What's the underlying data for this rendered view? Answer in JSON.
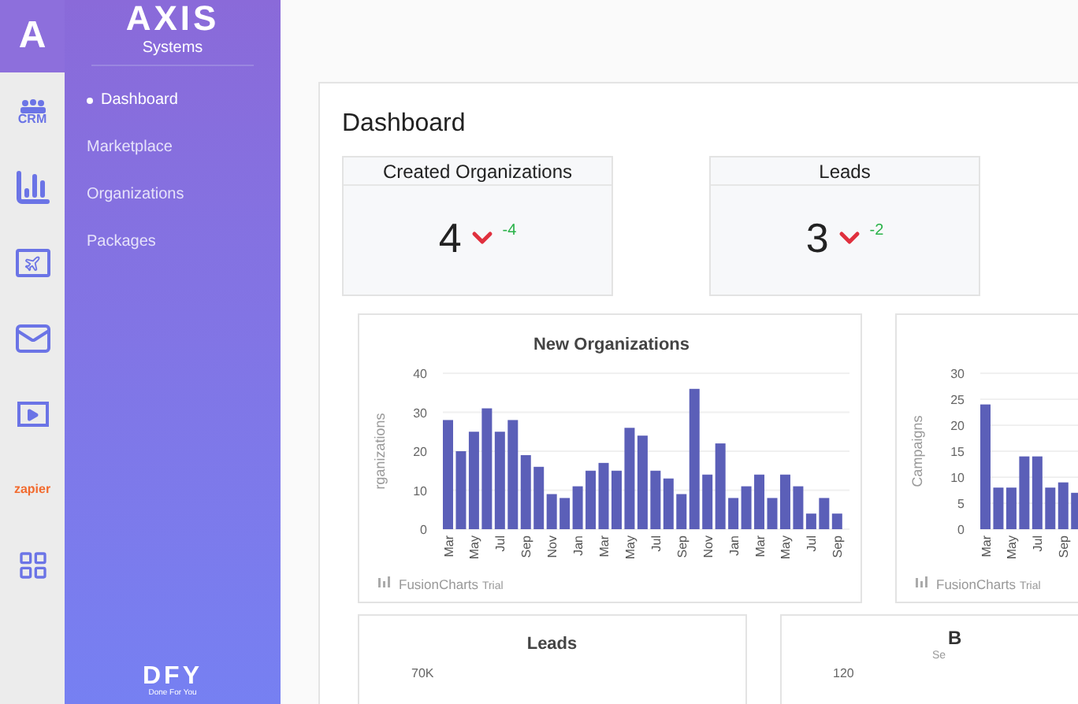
{
  "brand": {
    "logo_letter": "A",
    "name": "AXIS",
    "subtitle": "Systems",
    "footer_logo": "DFY",
    "footer_tagline": "Done For You"
  },
  "rail": [
    {
      "kind": "crm",
      "label": "CRM"
    },
    {
      "kind": "bars"
    },
    {
      "kind": "window"
    },
    {
      "kind": "mail"
    },
    {
      "kind": "video"
    },
    {
      "kind": "zapier",
      "label": "zapier"
    },
    {
      "kind": "widget"
    }
  ],
  "sidebar": {
    "items": [
      {
        "label": "Dashboard",
        "selected": true
      },
      {
        "label": "Marketplace",
        "selected": false
      },
      {
        "label": "Organizations",
        "selected": false
      },
      {
        "label": "Packages",
        "selected": false
      }
    ]
  },
  "page": {
    "title": "Dashboard"
  },
  "stats": [
    {
      "title": "Created Organizations",
      "value": "4",
      "kind": "down",
      "delta": "-4"
    },
    {
      "title": "Leads",
      "value": "3",
      "kind": "down",
      "delta": "-2"
    }
  ],
  "charts": [
    {
      "credit": "FusionCharts",
      "credit_suffix": "Trial",
      "chart_data": {
        "type": "bar",
        "title": "New Organizations",
        "ylabel": "rganizations",
        "grid": true,
        "categories": [
          "Mar",
          null,
          "May",
          null,
          "Jul",
          null,
          "Sep",
          null,
          "Nov",
          null,
          "Jan",
          null,
          "Mar",
          null,
          "May",
          null,
          "Jul",
          null,
          "Sep",
          null,
          "Nov",
          null,
          "Jan",
          null,
          "Mar",
          null,
          "May",
          null,
          "Jul",
          null,
          "Sep"
        ],
        "series": [
          {
            "color": "#5b5fb8",
            "values": [
              28,
              20,
              25,
              31,
              25,
              28,
              19,
              16,
              9,
              8,
              11,
              15,
              17,
              15,
              26,
              24,
              15,
              13,
              9,
              36,
              14,
              22,
              8,
              11,
              14,
              8,
              14,
              11,
              4,
              8,
              4
            ]
          }
        ],
        "ylim": [
          0,
          40
        ],
        "yticks": [
          0,
          10,
          20,
          30,
          40
        ]
      }
    },
    {
      "credit": "FusionCharts",
      "credit_suffix": "Trial",
      "chart_data": {
        "type": "bar",
        "ylabel": "Campaigns",
        "grid": true,
        "categories": [
          "Mar",
          null,
          "May",
          null,
          "Jul",
          null,
          "Sep",
          null
        ],
        "series": [
          {
            "color": "#5b5fb8",
            "values": [
              24,
              8,
              8,
              14,
              14,
              8,
              9,
              7
            ]
          }
        ],
        "ylim": [
          0,
          30
        ],
        "yticks": [
          0,
          5,
          10,
          15,
          20,
          25,
          30
        ]
      }
    }
  ],
  "bottom_cards": [
    {
      "title": "Leads",
      "tick": "70K"
    },
    {
      "title": "B",
      "subtitle": "Se",
      "tick": "120"
    }
  ]
}
